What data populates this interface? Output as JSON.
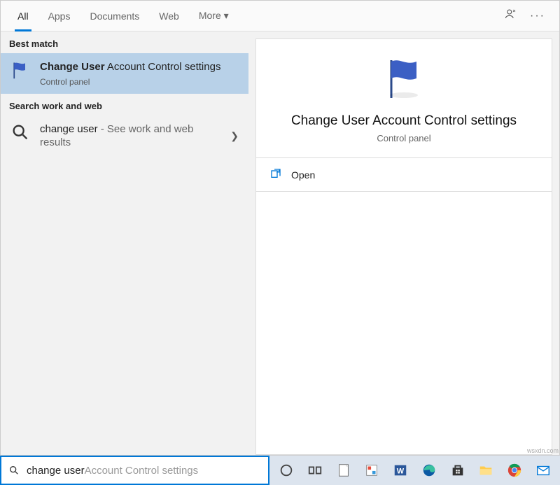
{
  "tabs": {
    "items": [
      {
        "label": "All",
        "active": true
      },
      {
        "label": "Apps",
        "active": false
      },
      {
        "label": "Documents",
        "active": false
      },
      {
        "label": "Web",
        "active": false
      },
      {
        "label": "More ▾",
        "active": false
      }
    ]
  },
  "sections": {
    "best_match": "Best match",
    "search_work_web": "Search work and web"
  },
  "best_match_result": {
    "title_bold": "Change User",
    "title_rest": " Account Control settings",
    "subtitle": "Control panel"
  },
  "web_result": {
    "query": "change user",
    "hint": " - See work and web results"
  },
  "preview": {
    "title": "Change User Account Control settings",
    "subtitle": "Control panel"
  },
  "actions": {
    "open": "Open"
  },
  "searchbox": {
    "typed": "change user",
    "ghost": " Account Control settings"
  },
  "watermark": "wsxdn.com"
}
